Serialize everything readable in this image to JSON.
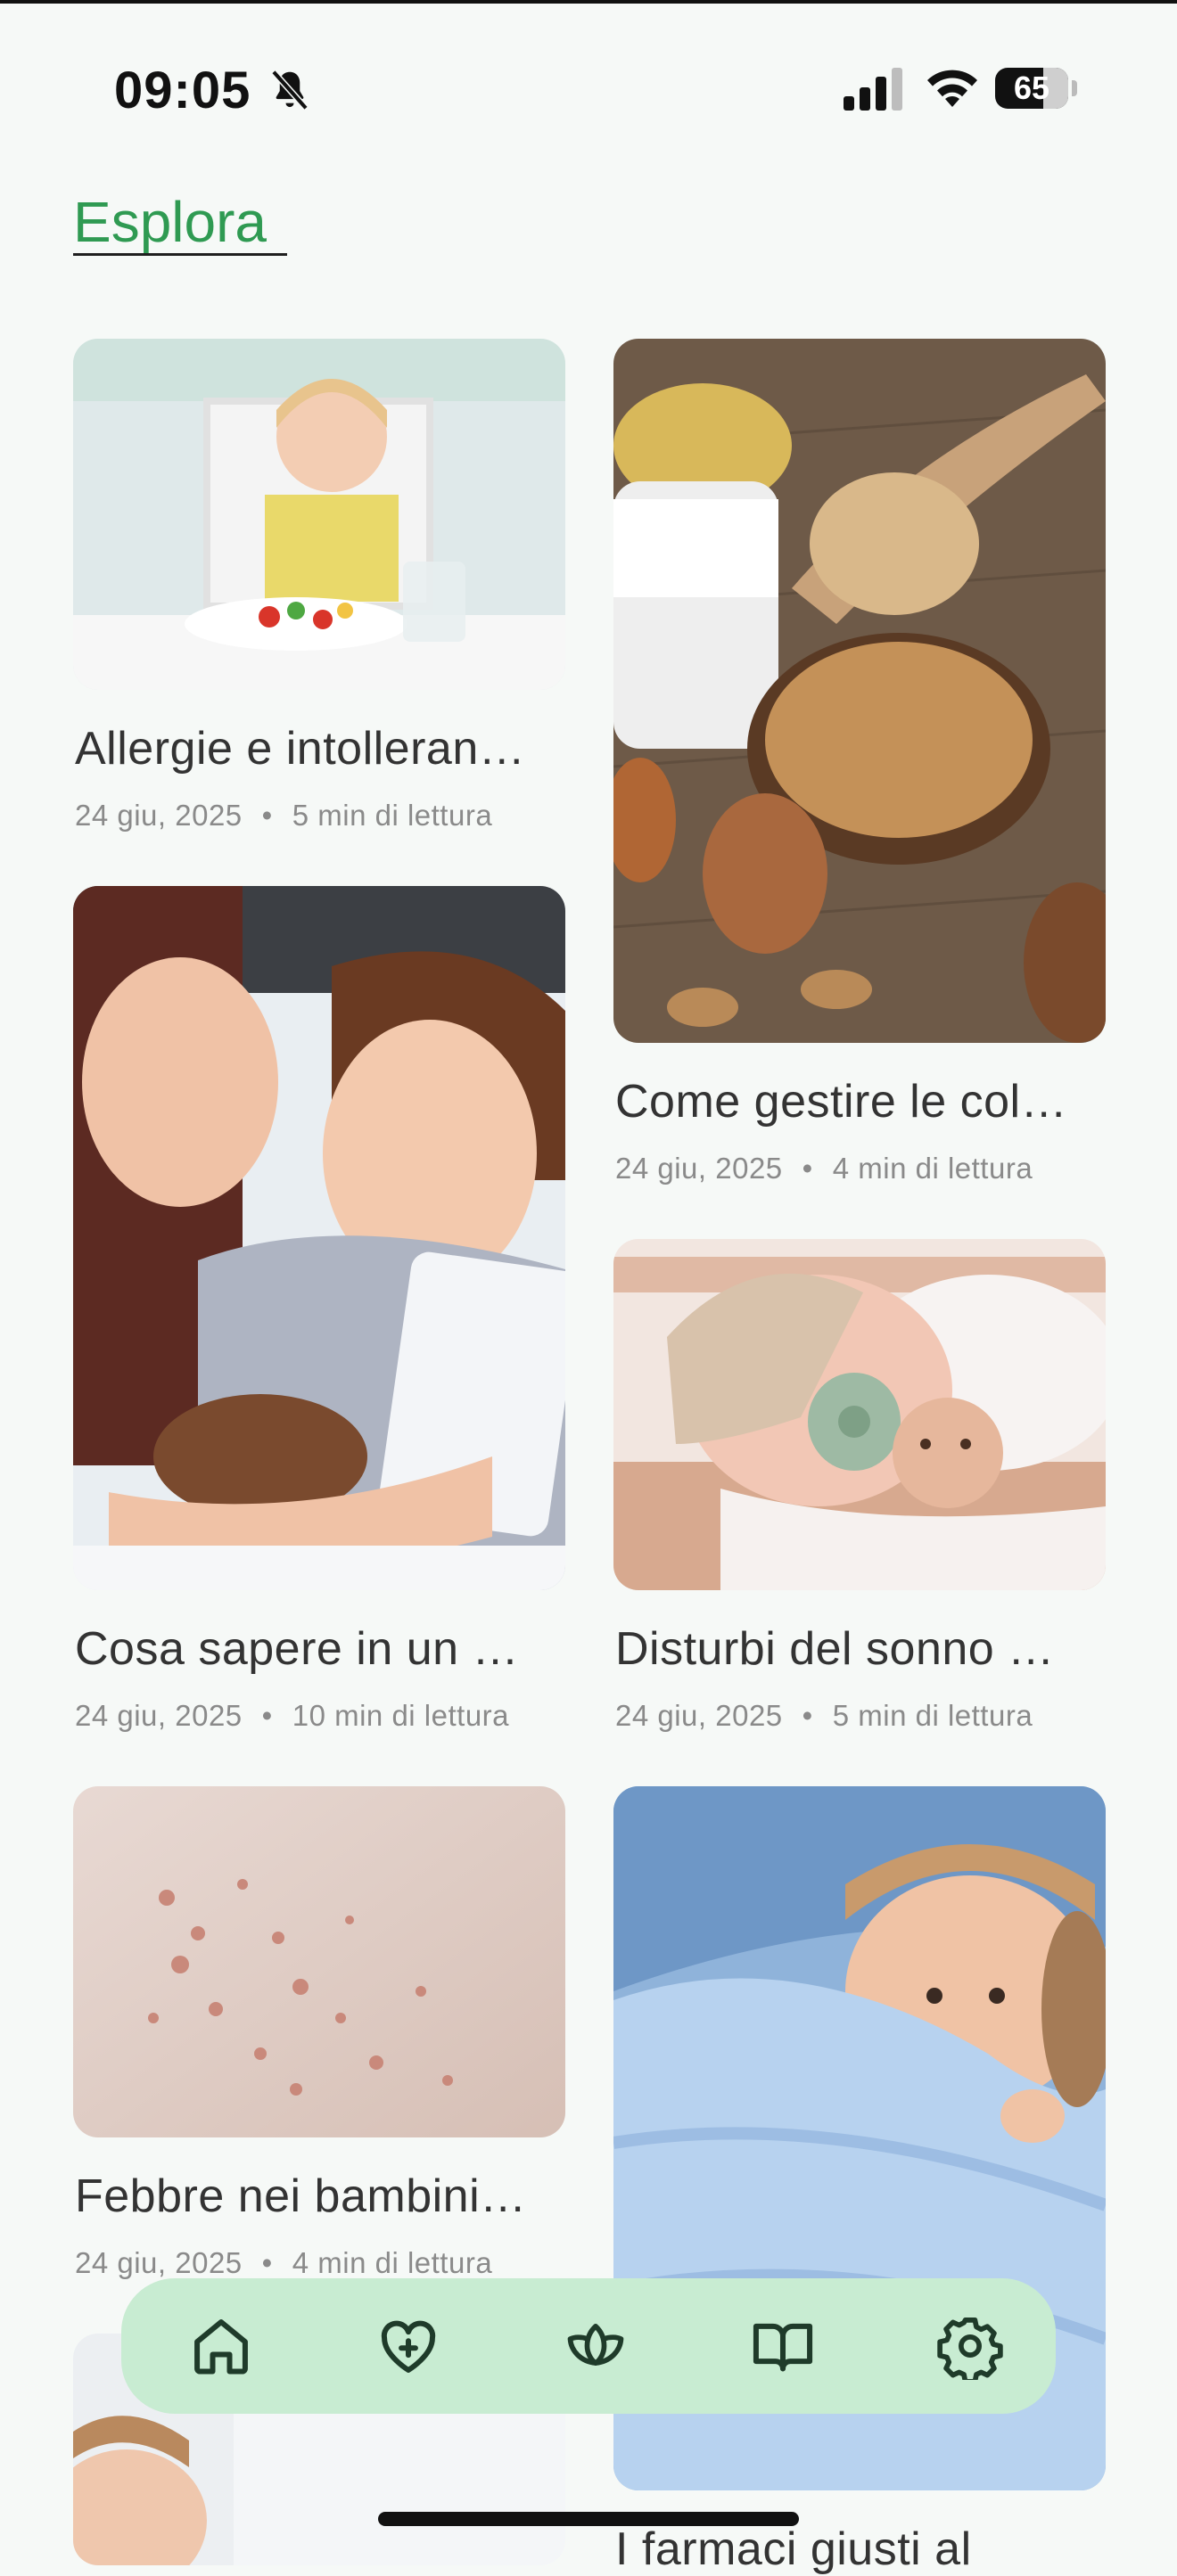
{
  "status_bar": {
    "time": "09:05",
    "battery": "65"
  },
  "header": {
    "title": "Esplora"
  },
  "articles": [
    {
      "title": "Allergie e intolleran…",
      "date": "24 giu, 2025",
      "read_time": "5 min di lettura",
      "image": "toddler-eating-vegetables"
    },
    {
      "title": "Come gestire le col…",
      "date": "24 giu, 2025",
      "read_time": "4 min di lettura",
      "image": "milk-peanuts-soy-eggs"
    },
    {
      "title": "Cosa sapere in un …",
      "date": "24 giu, 2025",
      "read_time": "10 min di lettura",
      "image": "mother-daughter-tablet"
    },
    {
      "title": "Disturbi del sonno …",
      "date": "24 giu, 2025",
      "read_time": "5 min di lettura",
      "image": "baby-with-pacifier"
    },
    {
      "title": "Febbre nei bambini…",
      "date": "24 giu, 2025",
      "read_time": "4 min di lettura",
      "image": "skin-rash"
    },
    {
      "title": "I farmaci giusti al",
      "image": "child-under-blanket"
    },
    {
      "image": "child-partial"
    }
  ],
  "bottom_nav": [
    {
      "name": "home-icon"
    },
    {
      "name": "heart-plus-icon"
    },
    {
      "name": "lotus-icon"
    },
    {
      "name": "book-icon"
    },
    {
      "name": "gear-icon"
    }
  ],
  "colors": {
    "accent": "#2f9a52",
    "nav_bg": "#c8ecd2",
    "background": "#f6f9f7"
  }
}
